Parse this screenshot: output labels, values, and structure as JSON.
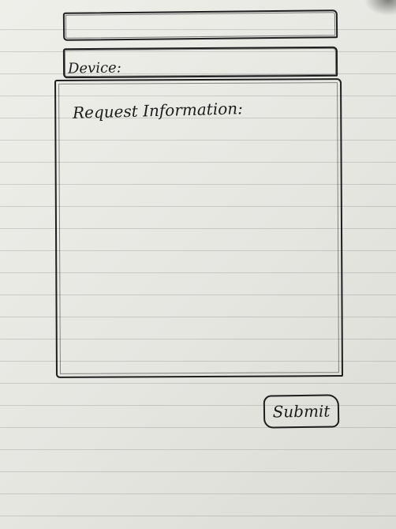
{
  "form": {
    "title_value": "",
    "device_label": "Device:",
    "request_label": "Request Information:",
    "submit_label": "Submit"
  }
}
